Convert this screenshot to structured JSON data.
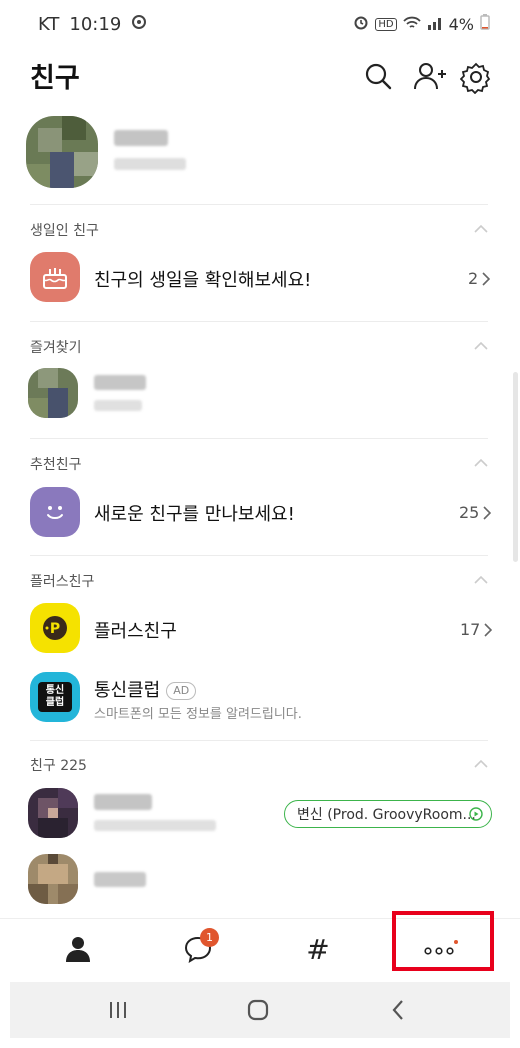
{
  "status_bar": {
    "carrier": "KT",
    "time": "10:19",
    "hd": "HD",
    "battery": "4%"
  },
  "header": {
    "title": "친구"
  },
  "sections": {
    "birthday": {
      "title": "생일인 친구",
      "row_label": "친구의 생일을 확인해보세요!",
      "count": "2"
    },
    "favorites": {
      "title": "즐겨찾기"
    },
    "recommended": {
      "title": "추천친구",
      "row_label": "새로운 친구를 만나보세요!",
      "count": "25"
    },
    "plus": {
      "title": "플러스친구",
      "plus_row": {
        "label": "플러스친구",
        "count": "17"
      },
      "ad_row": {
        "label": "통신클럽",
        "badge": "AD",
        "description": "스마트폰의 모든 정보를 알려드립니다.",
        "icon_text_1": "통신",
        "icon_text_2": "클럽"
      }
    },
    "friends": {
      "title": "친구 225",
      "music_status": "변신 (Prod. GroovyRoom..."
    }
  },
  "tabbar": {
    "chat_badge": "1",
    "hash_label": "#"
  },
  "colors": {
    "accent_red": "#e8001c",
    "badge_orange": "#e0562e",
    "music_green": "#3cb44b",
    "plus_yellow": "#f5e200"
  }
}
